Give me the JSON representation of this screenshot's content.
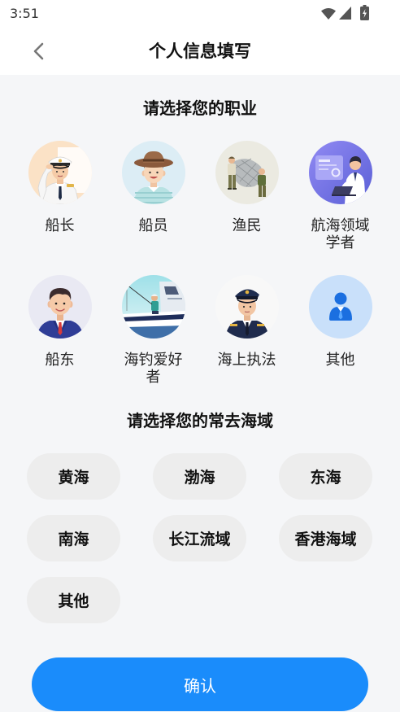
{
  "status_bar": {
    "time": "3:51",
    "icons": [
      "wifi-icon",
      "cellular-signal-icon",
      "battery-charging-icon"
    ]
  },
  "header": {
    "title": "个人信息填写",
    "back_icon": "chevron-left-icon"
  },
  "occupation": {
    "title": "请选择您的职业",
    "items": [
      {
        "label": "船长",
        "icon": "ship-captain-avatar"
      },
      {
        "label": "船员",
        "icon": "ship-crew-avatar"
      },
      {
        "label": "渔民",
        "icon": "fishermen-avatar"
      },
      {
        "label": "航海领域学者",
        "icon": "maritime-scholar-avatar"
      },
      {
        "label": "船东",
        "icon": "ship-owner-avatar"
      },
      {
        "label": "海钓爱好者",
        "icon": "sea-angler-avatar"
      },
      {
        "label": "海上执法",
        "icon": "maritime-law-enforcement-avatar"
      },
      {
        "label": "其他",
        "icon": "other-person-icon"
      }
    ]
  },
  "sea_area": {
    "title": "请选择您的常去海域",
    "options": [
      "黄海",
      "渤海",
      "东海",
      "南海",
      "长江流域",
      "香港海域",
      "其他"
    ]
  },
  "confirm_button": {
    "label": "确认"
  },
  "colors": {
    "accent": "#1a8cfb",
    "page_background": "#f5f6f8",
    "chip_background": "#ededed"
  }
}
